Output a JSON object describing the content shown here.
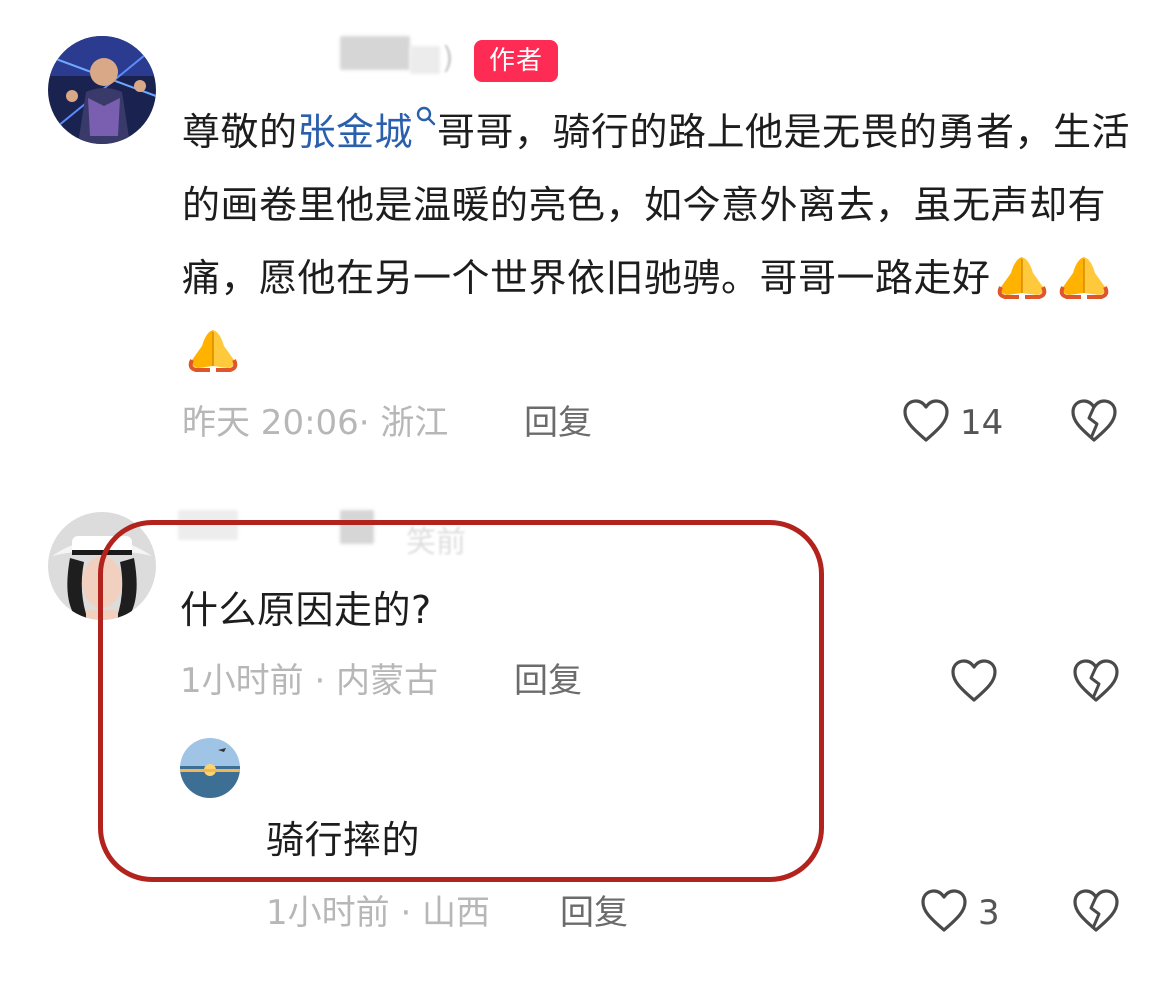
{
  "comments": [
    {
      "author_badge": "作者",
      "text_before": "尊敬的",
      "mention": "张金城",
      "text_after": "哥哥，骑行的路上他是无畏的勇者，生活的画卷里他是温暖的亮色，如今意外离去，虽无声却有痛，愿他在另一个世界依旧驰骋。哥哥一路走好",
      "emoji": [
        "folded-hands",
        "folded-hands",
        "folded-hands"
      ],
      "meta": "昨天 20:06· 浙江",
      "reply_label": "回复",
      "like_count": "14",
      "name_fragment": ")"
    },
    {
      "text": "什么原因走的?",
      "meta": "1小时前 · 内蒙古",
      "reply_label": "回复",
      "like_count": "",
      "name_fragment": "笑前"
    },
    {
      "text": "骑行摔的",
      "meta": "1小时前 · 山西",
      "reply_label": "回复",
      "like_count": "3"
    }
  ],
  "colors": {
    "author_badge": "#fe2c55",
    "mention": "#2a5fad",
    "highlight_outline": "#b3231e"
  }
}
